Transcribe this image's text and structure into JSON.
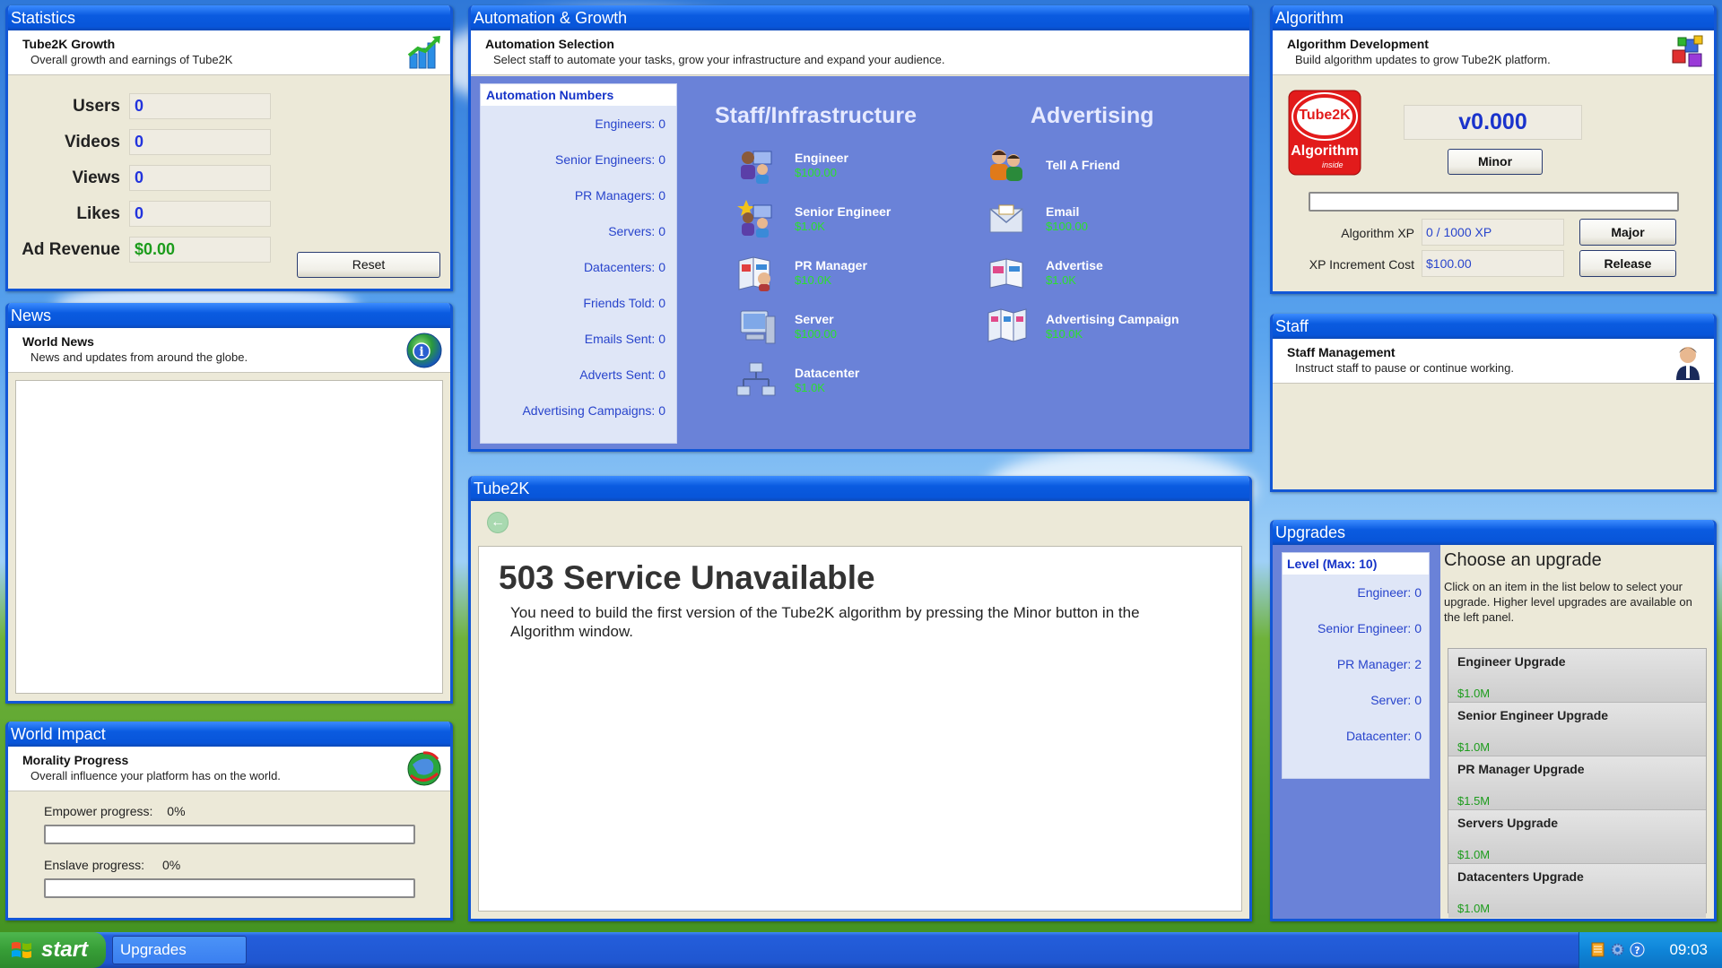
{
  "statistics": {
    "title": "Statistics",
    "header_title": "Tube2K Growth",
    "header_sub": "Overall growth and earnings of Tube2K",
    "rows": [
      {
        "label": "Users",
        "value": "0"
      },
      {
        "label": "Videos",
        "value": "0"
      },
      {
        "label": "Views",
        "value": "0"
      },
      {
        "label": "Likes",
        "value": "0"
      },
      {
        "label": "Ad Revenue",
        "value": "$0.00"
      }
    ],
    "reset_label": "Reset"
  },
  "news": {
    "title": "News",
    "header_title": "World News",
    "header_sub": "News and updates from around the globe."
  },
  "world_impact": {
    "title": "World Impact",
    "header_title": "Morality Progress",
    "header_sub": "Overall influence your platform has on the world.",
    "empower_label": "Empower progress:",
    "empower_value": "0%",
    "enslave_label": "Enslave progress:",
    "enslave_value": "0%"
  },
  "automation": {
    "title": "Automation & Growth",
    "header_title": "Automation Selection",
    "header_sub": "Select staff to automate your tasks, grow your infrastructure and expand your audience.",
    "numbers_title": "Automation Numbers",
    "numbers": [
      "Engineers: 0",
      "Senior Engineers: 0",
      "PR Managers: 0",
      "Servers: 0",
      "Datacenters: 0",
      "Friends Told: 0",
      "Emails Sent: 0",
      "Adverts Sent: 0",
      "Advertising Campaigns: 0"
    ],
    "staff_title": "Staff/Infrastructure",
    "advertising_title": "Advertising",
    "staff_items": [
      {
        "name": "Engineer",
        "price": "$100.00",
        "icon": "engineer-icon"
      },
      {
        "name": "Senior Engineer",
        "price": "$1.0K",
        "icon": "senior-engineer-icon"
      },
      {
        "name": "PR Manager",
        "price": "$10.0K",
        "icon": "pr-manager-icon"
      },
      {
        "name": "Server",
        "price": "$100.00",
        "icon": "server-icon"
      },
      {
        "name": "Datacenter",
        "price": "$1.0K",
        "icon": "datacenter-icon"
      }
    ],
    "ad_items": [
      {
        "name": "Tell A Friend",
        "price": "",
        "icon": "tell-a-friend-icon"
      },
      {
        "name": "Email",
        "price": "$100.00",
        "icon": "email-icon"
      },
      {
        "name": "Advertise",
        "price": "$1.0K",
        "icon": "advertise-icon"
      },
      {
        "name": "Advertising Campaign",
        "price": "$10.0K",
        "icon": "advertising-campaign-icon"
      }
    ]
  },
  "tube2k": {
    "title": "Tube2K",
    "error_title": "503 Service Unavailable",
    "error_message": "You need to build the first version of the Tube2K algorithm by pressing the Minor button in the Algorithm window."
  },
  "algorithm": {
    "title": "Algorithm",
    "header_title": "Algorithm Development",
    "header_sub": "Build algorithm updates to grow Tube2K platform.",
    "logo_top": "Tube2K",
    "logo_bottom": "Algorithm",
    "logo_small": "inside",
    "version": "v0.000",
    "minor_label": "Minor",
    "xp_label": "Algorithm XP",
    "xp_value": "0 / 1000 XP",
    "cost_label": "XP Increment Cost",
    "cost_value": "$100.00",
    "major_label": "Major",
    "release_label": "Release"
  },
  "staff": {
    "title": "Staff",
    "header_title": "Staff Management",
    "header_sub": "Instruct staff to pause or continue working."
  },
  "upgrades": {
    "title": "Upgrades",
    "level_title": "Level (Max: 10)",
    "levels": [
      "Engineer: 0",
      "Senior Engineer: 0",
      "PR Manager: 2",
      "Server: 0",
      "Datacenter: 0"
    ],
    "choose_title": "Choose an upgrade",
    "choose_desc": "Click on an item in the list below to select your upgrade. Higher level upgrades are available on the left panel.",
    "cards": [
      {
        "name": "Engineer Upgrade",
        "price": "$1.0M"
      },
      {
        "name": "Senior Engineer Upgrade",
        "price": "$1.0M"
      },
      {
        "name": "PR Manager Upgrade",
        "price": "$1.5M"
      },
      {
        "name": "Servers Upgrade",
        "price": "$1.0M"
      },
      {
        "name": "Datacenters Upgrade",
        "price": "$1.0M"
      }
    ]
  },
  "taskbar": {
    "start_label": "start",
    "task_label": "Upgrades",
    "clock": "09:03"
  },
  "colors": {
    "title_blue": "#0855d9",
    "value_blue": "#2233dd",
    "money_green": "#1c9c1c",
    "price_green": "#2ce02c",
    "automation_bg": "#6a82d8"
  }
}
